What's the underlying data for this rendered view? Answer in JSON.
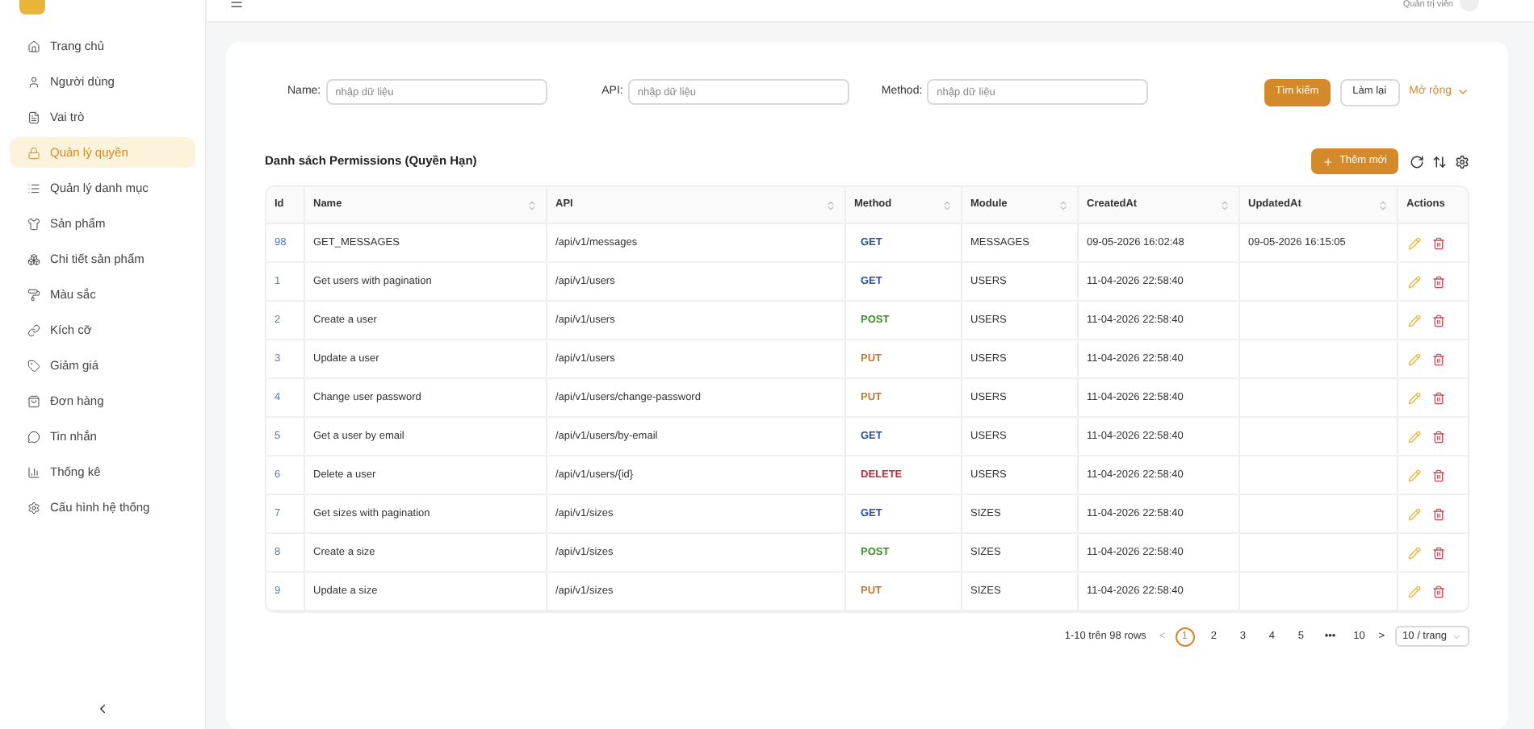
{
  "header": {
    "user_role": "Quản trị viên"
  },
  "sidebar": {
    "items": [
      {
        "label": "Trang chủ",
        "selected": false
      },
      {
        "label": "Người dùng",
        "selected": false
      },
      {
        "label": "Vai trò",
        "selected": false
      },
      {
        "label": "Quản lý quyền",
        "selected": true
      },
      {
        "label": "Quản lý danh mục",
        "selected": false
      },
      {
        "label": "Sản phẩm",
        "selected": false
      },
      {
        "label": "Chi tiết sản phẩm",
        "selected": false
      },
      {
        "label": "Màu sắc",
        "selected": false
      },
      {
        "label": "Kích cỡ",
        "selected": false
      },
      {
        "label": "Giảm giá",
        "selected": false
      },
      {
        "label": "Đơn hàng",
        "selected": false
      },
      {
        "label": "Tin nhắn",
        "selected": false
      },
      {
        "label": "Thống kê",
        "selected": false
      },
      {
        "label": "Cấu hình hệ thống",
        "selected": false
      }
    ]
  },
  "filters": [
    {
      "label": "Name:",
      "placeholder": "nhập dữ liệu"
    },
    {
      "label": "API:",
      "placeholder": "nhập dữ liệu"
    },
    {
      "label": "Method:",
      "placeholder": "nhập dữ liệu"
    }
  ],
  "filter_buttons": {
    "search": "Tìm kiếm",
    "reset": "Làm lại",
    "expand": "Mở rộng"
  },
  "table_title": "Danh sách Permissions (Quyền Hạn)",
  "add_button": "Thêm mới",
  "table": {
    "columns": [
      {
        "label": "Id",
        "sortable": false
      },
      {
        "label": "Name",
        "sortable": true
      },
      {
        "label": "API",
        "sortable": true
      },
      {
        "label": "Method",
        "sortable": true
      },
      {
        "label": "Module",
        "sortable": true
      },
      {
        "label": "CreatedAt",
        "sortable": true
      },
      {
        "label": "UpdatedAt",
        "sortable": true
      },
      {
        "label": "Actions",
        "sortable": false
      }
    ],
    "rows": [
      {
        "id": "98",
        "name": "GET_MESSAGES",
        "api": "/api/v1/messages",
        "method": "GET",
        "kind": "read",
        "module": "MESSAGES",
        "created": "09-05-2026 16:02:48",
        "updated": "09-05-2026 16:15:05"
      },
      {
        "id": "1",
        "name": "Get users with pagination",
        "api": "/api/v1/users",
        "method": "GET",
        "kind": "read",
        "module": "USERS",
        "created": "11-04-2026 22:58:40"
      },
      {
        "id": "2",
        "name": "Create a user",
        "api": "/api/v1/users",
        "method": "POST",
        "kind": "create",
        "module": "USERS",
        "created": "11-04-2026 22:58:40"
      },
      {
        "id": "3",
        "name": "Update a user",
        "api": "/api/v1/users",
        "method": "PUT",
        "kind": "update",
        "module": "USERS",
        "created": "11-04-2026 22:58:40"
      },
      {
        "id": "4",
        "name": "Change user password",
        "api": "/api/v1/users/change-password",
        "method": "PUT",
        "kind": "update",
        "module": "USERS",
        "created": "11-04-2026 22:58:40"
      },
      {
        "id": "5",
        "name": "Get a user by email",
        "api": "/api/v1/users/by-email",
        "method": "GET",
        "kind": "read",
        "module": "USERS",
        "created": "11-04-2026 22:58:40"
      },
      {
        "id": "6",
        "name": "Delete a user",
        "api": "/api/v1/users/{id}",
        "method": "DELETE",
        "kind": "delete",
        "module": "USERS",
        "created": "11-04-2026 22:58:40"
      },
      {
        "id": "7",
        "name": "Get sizes with pagination",
        "api": "/api/v1/sizes",
        "method": "GET",
        "kind": "read",
        "module": "SIZES",
        "created": "11-04-2026 22:58:40"
      },
      {
        "id": "8",
        "name": "Create a size",
        "api": "/api/v1/sizes",
        "method": "POST",
        "kind": "create",
        "module": "SIZES",
        "created": "11-04-2026 22:58:40"
      },
      {
        "id": "9",
        "name": "Update a size",
        "api": "/api/v1/sizes",
        "method": "PUT",
        "kind": "update",
        "module": "SIZES",
        "created": "11-04-2026 22:58:40"
      }
    ]
  },
  "pagination": {
    "summary": "1-10 trên 98 rows",
    "prev": "<",
    "next": ">",
    "pages": [
      {
        "label": "1",
        "selected": true
      },
      {
        "label": "2",
        "selected": false
      },
      {
        "label": "3",
        "selected": false
      },
      {
        "label": "4",
        "selected": false
      },
      {
        "label": "5",
        "selected": false
      },
      {
        "label": "•••",
        "selected": false
      },
      {
        "label": "10",
        "selected": false
      }
    ],
    "page_size": "10 / trang"
  }
}
